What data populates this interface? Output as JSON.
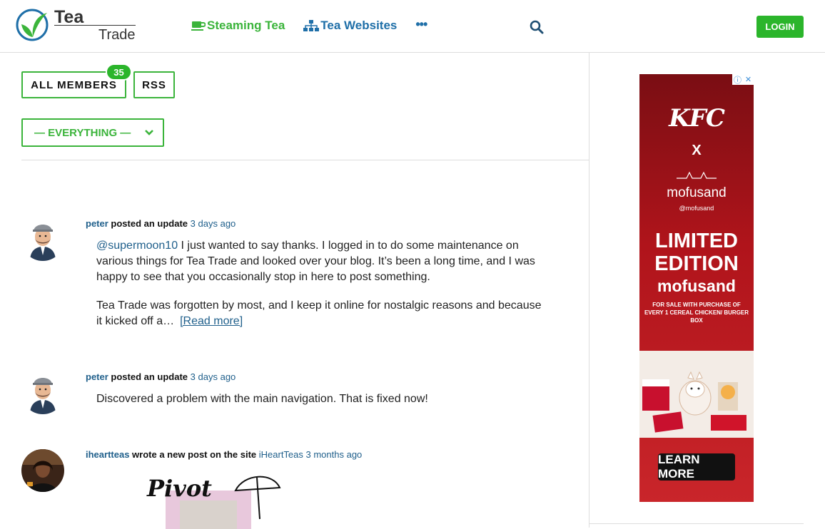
{
  "header": {
    "logo_top": "Tea",
    "logo_bottom": "Trade",
    "nav": [
      {
        "label": "Steaming Tea"
      },
      {
        "label": "Tea Websites"
      }
    ],
    "more_label": "•••",
    "login_label": "LOGIN"
  },
  "filters": {
    "all_members_label": "ALL MEMBERS",
    "members_count": "35",
    "rss_label": "RSS",
    "select_value": "— EVERYTHING —"
  },
  "activities": [
    {
      "user": "peter",
      "action": "posted an update",
      "time": "3 days ago",
      "mention": "@supermoon10",
      "p1_rest": " I just wanted to say thanks. I logged in to do some maintenance on various things for Tea Trade and looked over your blog. It’s been a long time, and I was happy to see that you occasionally stop in here to post something.",
      "p2": "Tea Trade was forgotten by most, and I keep it online for nostalgic reasons and because it kicked off a…",
      "read_more": "[Read more]"
    },
    {
      "user": "peter",
      "action": "posted an update",
      "time": "3 days ago",
      "text": "Discovered a problem with the main navigation. That is fixed now!"
    },
    {
      "user": "iheartteas",
      "action": "wrote a new post on the site",
      "site": "iHeartTeas",
      "time": "3 months ago",
      "thumb_text": "Pivot"
    }
  ],
  "ad": {
    "brand": "KFC",
    "x": "X",
    "partner": "mofusand",
    "partner_handle": "@mofusand",
    "headline_1": "LIMITED",
    "headline_2": "EDITION",
    "headline_3": "mofusand",
    "sale_text": "FOR SALE WITH PURCHASE OF EVERY 1 CEREAL CHICKEN/ BURGER BOX",
    "cta": "LEARN MORE",
    "info_icon": "ⓘ",
    "close_icon": "✕"
  },
  "colors": {
    "green": "#3bb43b",
    "blue": "#1f6fa8",
    "link": "#1f5f8b",
    "ad_red": "#b0141b"
  }
}
